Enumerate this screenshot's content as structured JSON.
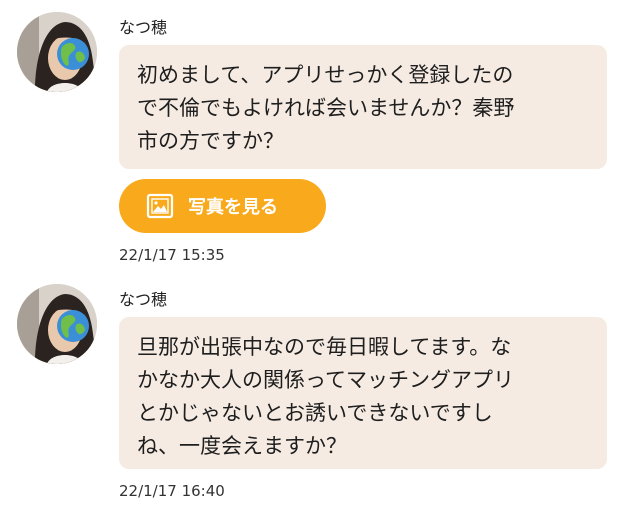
{
  "messages": [
    {
      "sender": "なつ穂",
      "avatar_icon": "person-avatar-with-globe-sticker",
      "lines": [
        "初めまして、アプリせっかく登録したの",
        "で不倫でもよければ会いませんか？秦野",
        "市の方ですか？"
      ],
      "photo_button": {
        "icon": "image-icon",
        "label": "写真を見る"
      },
      "timestamp": "22/1/17 15:35"
    },
    {
      "sender": "なつ穂",
      "avatar_icon": "person-avatar-with-globe-sticker",
      "lines": [
        "旦那が出張中なので毎日暇してます。な",
        "かなか大人の関係ってマッチングアプリ",
        "とかじゃないとお誘いできないですし",
        "ね、一度会えますか？"
      ],
      "timestamp": "22/1/17 16:40"
    }
  ],
  "colors": {
    "bubble": "#f5ebe3",
    "button": "#f9a91c",
    "button_text": "#ffffff",
    "globe_sea": "#3b8fd6",
    "globe_land": "#6fbf4a"
  }
}
